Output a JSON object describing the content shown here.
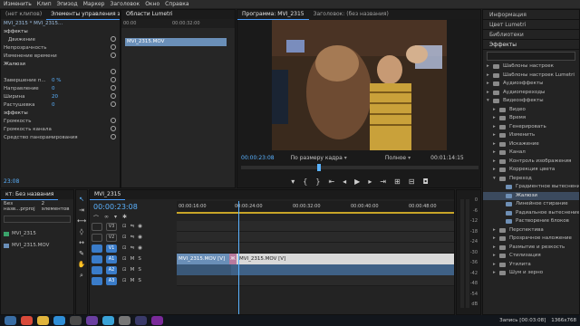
{
  "menu": [
    "Изменить",
    "Клип",
    "Эпизод",
    "Маркер",
    "Заголовок",
    "Окно",
    "Справка"
  ],
  "effect_panel": {
    "tabs": [
      "(нет клипов)",
      "Элементы управления эффектами",
      "Области Lumetri"
    ],
    "sequence_tab": "MVI_2315 * MVI_2315...",
    "rows": [
      {
        "label": "эффекты",
        "value": "",
        "hdr": true
      },
      {
        "label": "Движение",
        "value": "",
        "indent": true
      },
      {
        "label": "Непрозрачность",
        "value": ""
      },
      {
        "label": "Изменение времени",
        "value": ""
      },
      {
        "label": "Жалюзи",
        "value": "",
        "hdr": true
      },
      {
        "label": "",
        "value": ""
      },
      {
        "label": "Завершение п...",
        "value": "0 %"
      },
      {
        "label": "Направление",
        "value": "0"
      },
      {
        "label": "Ширина",
        "value": "20"
      },
      {
        "label": "Растушевка",
        "value": "0"
      },
      {
        "label": "эффекты",
        "value": "",
        "hdr": true
      },
      {
        "label": "Громкость",
        "value": ""
      },
      {
        "label": "Громкость канала",
        "value": ""
      },
      {
        "label": "Средство панорамирования",
        "value": ""
      }
    ],
    "timecode": "23:08",
    "ruler_start": "00:00",
    "ruler_mark": "00:00:32:00",
    "clip_label": "MVI_2315.MOV"
  },
  "program": {
    "tabs": [
      "Программа: MVI_2315",
      "Заголовок: (без названия)"
    ],
    "timecode": "00:00:23:08",
    "fit": "По размеру кадра",
    "quality": "Полное",
    "duration": "00:01:14:15"
  },
  "right_panel": {
    "sections": [
      "Информация",
      "Цвет Lumetri",
      "Библиотеки",
      "Эффекты"
    ],
    "tree": [
      {
        "label": "Шаблоны настроек",
        "level": 0
      },
      {
        "label": "Шаблоны настроек Lumetri",
        "level": 0
      },
      {
        "label": "Аудиоэффекты",
        "level": 0
      },
      {
        "label": "Аудиопереходы",
        "level": 0
      },
      {
        "label": "Видеоэффекты",
        "level": 0,
        "open": true
      },
      {
        "label": "Видео",
        "level": 1
      },
      {
        "label": "Время",
        "level": 1
      },
      {
        "label": "Генерировать",
        "level": 1
      },
      {
        "label": "Изменить",
        "level": 1
      },
      {
        "label": "Искажение",
        "level": 1
      },
      {
        "label": "Канал",
        "level": 1
      },
      {
        "label": "Контроль изображения",
        "level": 1
      },
      {
        "label": "Коррекция цвета",
        "level": 1
      },
      {
        "label": "Переход",
        "level": 1,
        "open": true
      },
      {
        "label": "Градиентное вытеснение",
        "level": 2
      },
      {
        "label": "Жалюзи",
        "level": 2,
        "selected": true
      },
      {
        "label": "Линейное стирание",
        "level": 2
      },
      {
        "label": "Радиальное вытеснение",
        "level": 2
      },
      {
        "label": "Растворение блоков",
        "level": 2
      },
      {
        "label": "Перспектива",
        "level": 1
      },
      {
        "label": "Прозрачное наложение",
        "level": 1
      },
      {
        "label": "Размытие и резкость",
        "level": 1
      },
      {
        "label": "Стилизация",
        "level": 1
      },
      {
        "label": "Утилита",
        "level": 1
      },
      {
        "label": "Шум и зерно",
        "level": 1
      }
    ]
  },
  "project": {
    "tab": "кт: Без названия",
    "file": "Без назв...prproj",
    "count": "2 элементов",
    "items": [
      "MVI_2315",
      "MVI_2315.MOV"
    ]
  },
  "timeline": {
    "tab": "MVI_2315",
    "timecode": "00:00:23:08",
    "ruler": [
      "00:00",
      "00:00:16:00",
      "00:00:24:00",
      "00:00:32:00",
      "00:00:40:00",
      "00:00:48:00"
    ],
    "tracks": [
      {
        "name": "V3",
        "kind": "video"
      },
      {
        "name": "V2",
        "kind": "video"
      },
      {
        "name": "V1",
        "kind": "video",
        "active": true
      },
      {
        "name": "A1",
        "kind": "audio",
        "active": true
      },
      {
        "name": "A2",
        "kind": "audio",
        "active": true
      },
      {
        "name": "A3",
        "kind": "audio",
        "active": true
      }
    ],
    "clip1": "MVI_2315.MOV [V]",
    "clip2": "MVI_2315.MOV [V]",
    "transition": "Ж",
    "meter_ticks": [
      "0",
      "-6",
      "-12",
      "-18",
      "-24",
      "-30",
      "-36",
      "-42",
      "-48",
      "-54",
      "dB"
    ]
  },
  "taskbar": {
    "rec": "Запись [00:03:08]",
    "res": "1366x768"
  }
}
